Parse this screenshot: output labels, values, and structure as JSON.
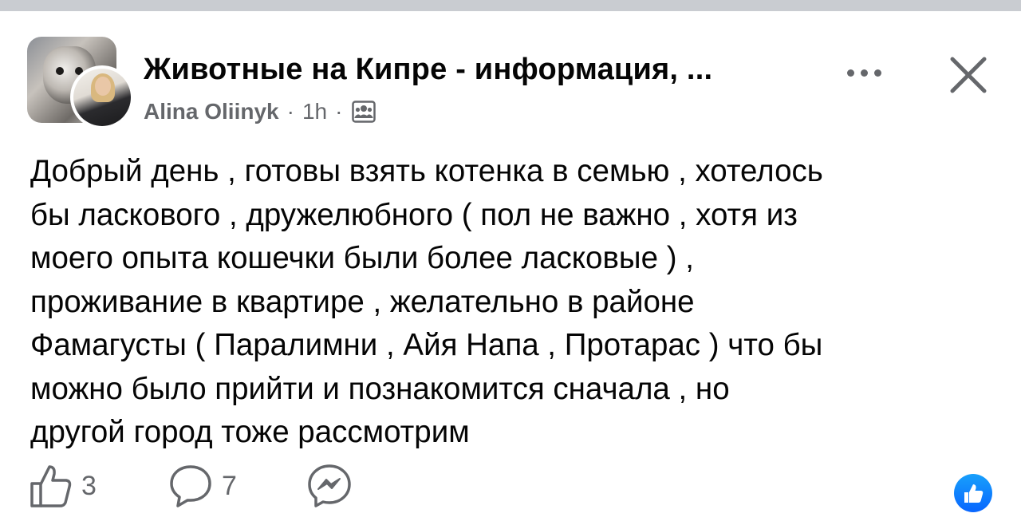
{
  "post": {
    "group_title": "Животные на Кипре - информация, ...",
    "author": "Alina Oliinyk",
    "time": "1h",
    "separator": "·",
    "audience_icon": "group-audience-icon",
    "body": "Добрый день , готовы взять котенка в семью , хотелось\nбы ласкового , дружелюбного ( пол не важно , хотя из\nмоего опыта кошечки были более ласковые ) ,\nпроживание в квартире , желательно в районе\nФамагусты ( Паралимни , Айя Напа , Протарас ) что бы\nможно было прийти и познакомится сначала , но\nдругой город тоже рассмотрим"
  },
  "actions": {
    "likes_count": "3",
    "comments_count": "7",
    "like_icon": "thumbs-up-icon",
    "comment_icon": "comment-bubble-icon",
    "share_icon": "messenger-icon",
    "reaction_icon": "like-reaction-icon"
  },
  "colors": {
    "primary_text": "#050505",
    "secondary_text": "#65676b",
    "accent": "#0866ff",
    "divider": "#c9ccd1"
  }
}
